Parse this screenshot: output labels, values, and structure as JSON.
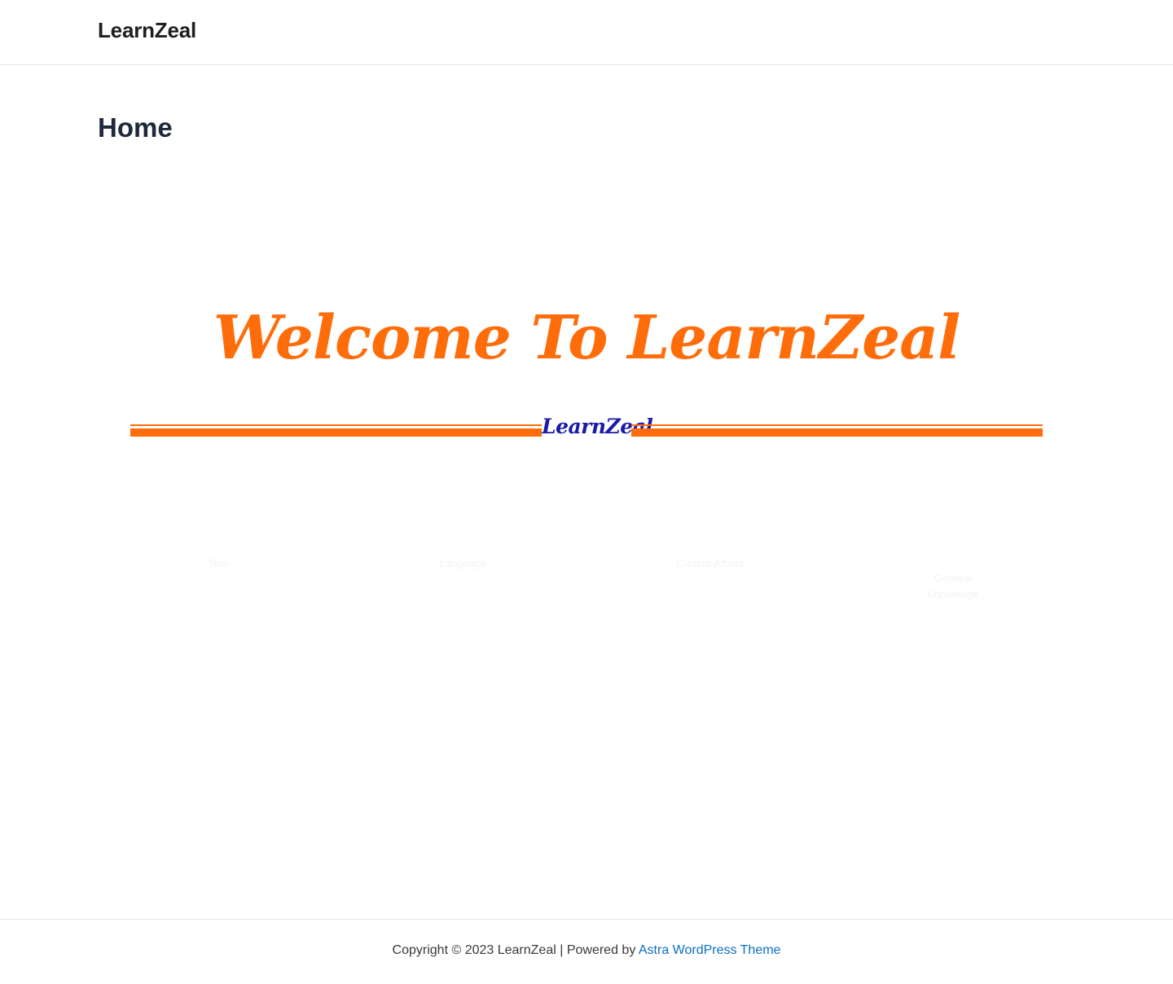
{
  "header": {
    "site_title": "LearnZeal"
  },
  "main": {
    "page_title": "Home",
    "welcome_heading": "Welcome To LearnZeal",
    "divider_text": "LearnZeal",
    "ghost_items": [
      "Tech",
      "Language",
      "Current Affairs",
      "General Knowledge"
    ]
  },
  "footer": {
    "copyright_prefix": "Copyright © 2023 LearnZeal | Powered by ",
    "theme_link": "Astra WordPress Theme"
  },
  "colors": {
    "accent_orange": "#ff6c0a",
    "divider_text_blue": "#1a1aa8",
    "link_blue": "#0b6ec5",
    "title_dark": "#1e293b"
  }
}
